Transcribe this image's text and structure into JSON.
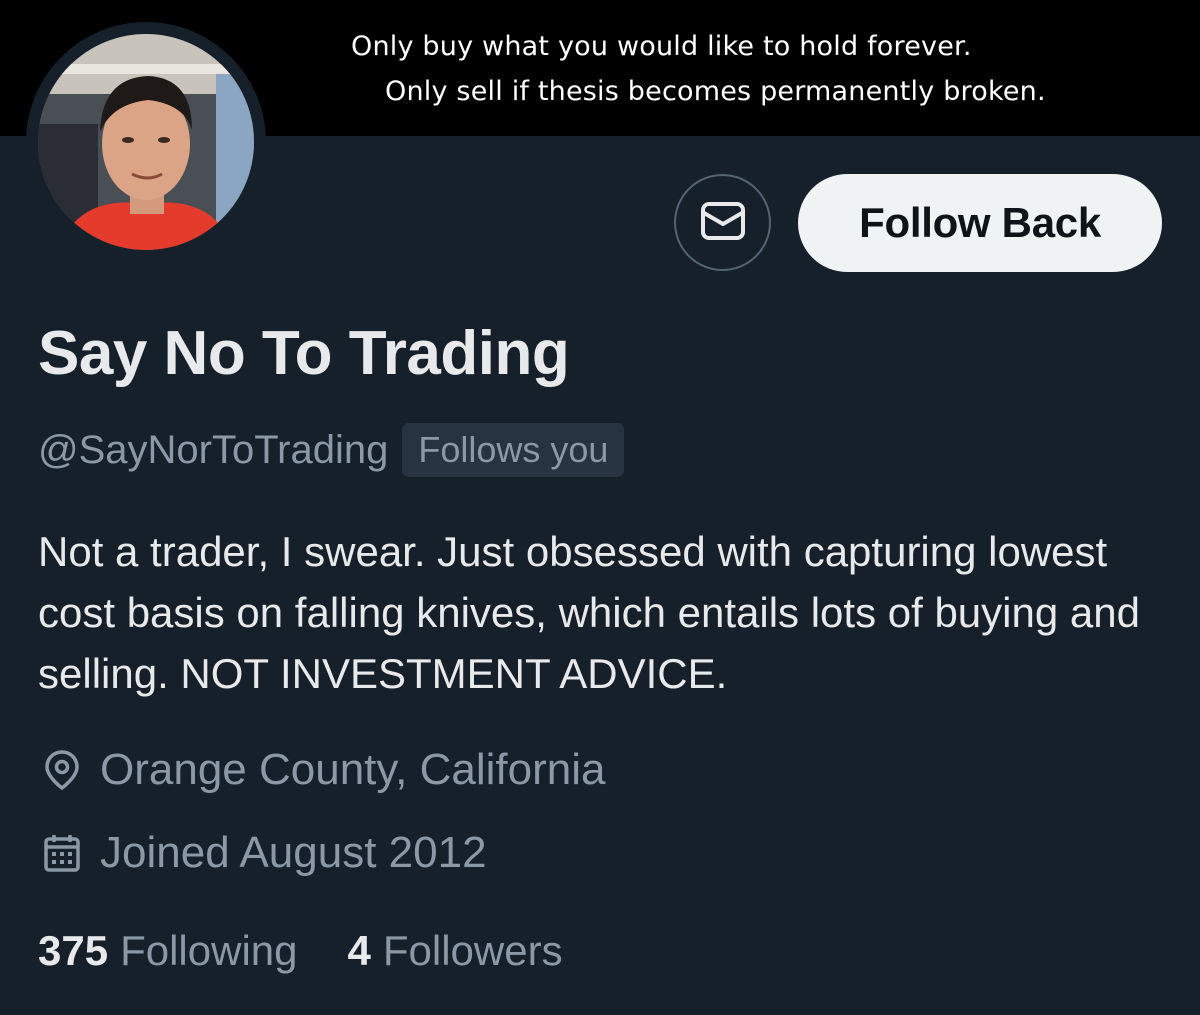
{
  "banner": {
    "line1": "Only buy what you would like to hold forever.",
    "line2": "Only sell if thesis becomes permanently broken."
  },
  "profile": {
    "display_name": "Say No To Trading",
    "handle": "@SayNorToTrading",
    "follows_you_badge": "Follows you",
    "bio": "Not a trader, I swear. Just obsessed with capturing lowest cost basis on falling knives, which entails lots of buying and selling. NOT INVESTMENT ADVICE.",
    "location": "Orange County, California",
    "joined": "Joined August 2012"
  },
  "actions": {
    "message_icon": "envelope-icon",
    "follow_back_label": "Follow Back"
  },
  "stats": {
    "following_count": "375",
    "following_label": "Following",
    "followers_count": "4",
    "followers_label": "Followers"
  },
  "icons": {
    "location": "location-pin-icon",
    "joined": "calendar-icon"
  },
  "colors": {
    "background": "#15202b",
    "banner": "#000000",
    "primary_text": "#e7e9ea",
    "secondary_text": "#8b98a5",
    "button_bg": "#eff3f4",
    "button_text": "#0f1419"
  }
}
